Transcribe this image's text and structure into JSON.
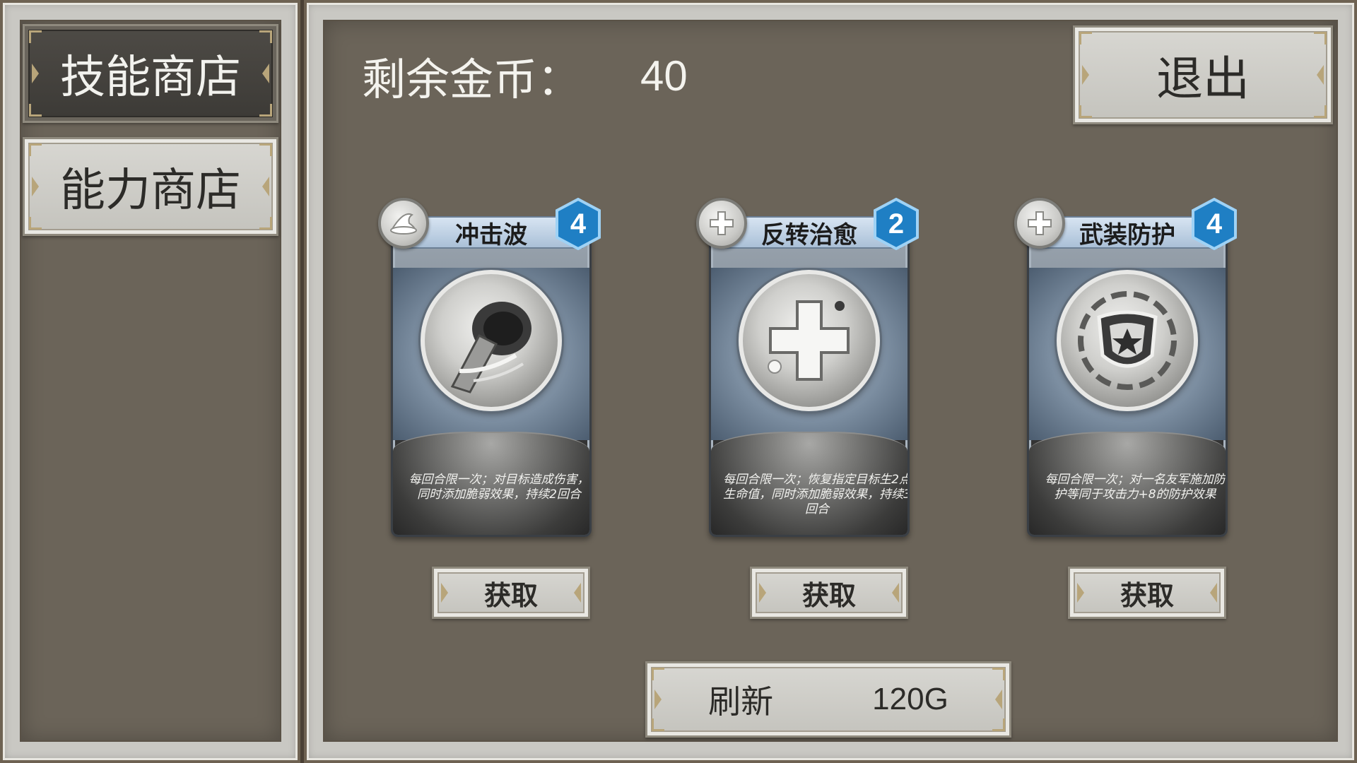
{
  "sidebar": {
    "tabs": [
      {
        "label": "技能商店",
        "active": true
      },
      {
        "label": "能力商店",
        "active": false
      }
    ]
  },
  "header": {
    "gold_label": "剩余金币：",
    "gold_value": "40",
    "exit_label": "退出"
  },
  "cards": [
    {
      "name": "冲击波",
      "cost": "4",
      "type_icon": "wizard-hat-icon",
      "art_icon": "shockwave-icon",
      "description": "每回合限一次；对目标造成伤害，同时添加脆弱效果，持续2回合",
      "get_label": "获取"
    },
    {
      "name": "反转治愈",
      "cost": "2",
      "type_icon": "cross-plus-icon",
      "art_icon": "heal-cross-icon",
      "description": "每回合限一次；恢复指定目标生2点生命值，同时添加脆弱效果，持续3回合",
      "get_label": "获取"
    },
    {
      "name": "武装防护",
      "cost": "4",
      "type_icon": "cross-plus-icon",
      "art_icon": "shield-star-icon",
      "description": "每回合限一次；对一名友军施加防护等同于攻击力+8的防护效果",
      "get_label": "获取"
    }
  ],
  "footer": {
    "refresh_label": "刷新",
    "refresh_price": "120G"
  },
  "colors": {
    "panel_bg": "#6b6459",
    "frame": "#c9c8c3",
    "cost_badge": "#1f7fc4",
    "card_title_bar": "#c3d5e8"
  }
}
